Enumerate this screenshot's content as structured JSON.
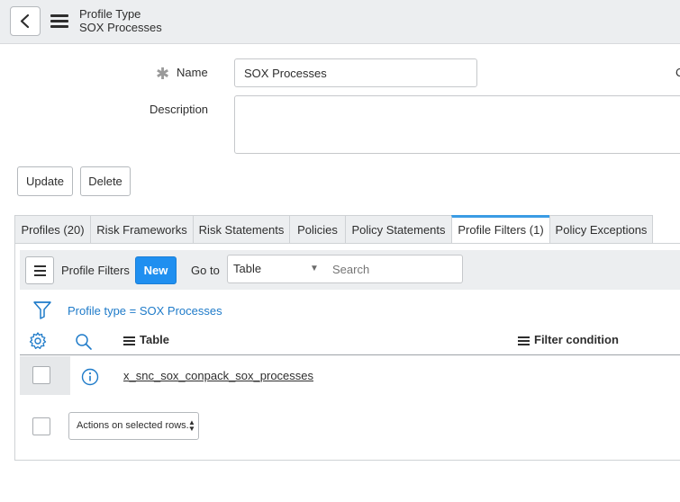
{
  "header": {
    "title": "Profile Type",
    "subtitle": "SOX Processes",
    "cutoff_text": "C"
  },
  "form": {
    "name_label": "Name",
    "name_value": "SOX Processes",
    "description_label": "Description",
    "description_value": "",
    "update_label": "Update",
    "delete_label": "Delete"
  },
  "tabs": [
    {
      "label": "Profiles (20)"
    },
    {
      "label": "Risk Frameworks"
    },
    {
      "label": "Risk Statements"
    },
    {
      "label": "Policies"
    },
    {
      "label": "Policy Statements"
    },
    {
      "label": "Profile Filters (1)"
    },
    {
      "label": "Policy Exceptions"
    }
  ],
  "list": {
    "title": "Profile Filters",
    "new_label": "New",
    "goto_label": "Go to",
    "select_value": "Table",
    "search_placeholder": "Search",
    "filter_text": "Profile type = SOX Processes",
    "columns": [
      "Table",
      "Filter condition"
    ],
    "rows": [
      {
        "table": "x_snc_sox_conpack_sox_processes",
        "filter_condition": ""
      }
    ],
    "actions_label": "Actions on selected rows..."
  },
  "colors": {
    "accent": "#1f8ff0",
    "link": "#1f7bc9",
    "active_tab": "#3b9ce4"
  }
}
